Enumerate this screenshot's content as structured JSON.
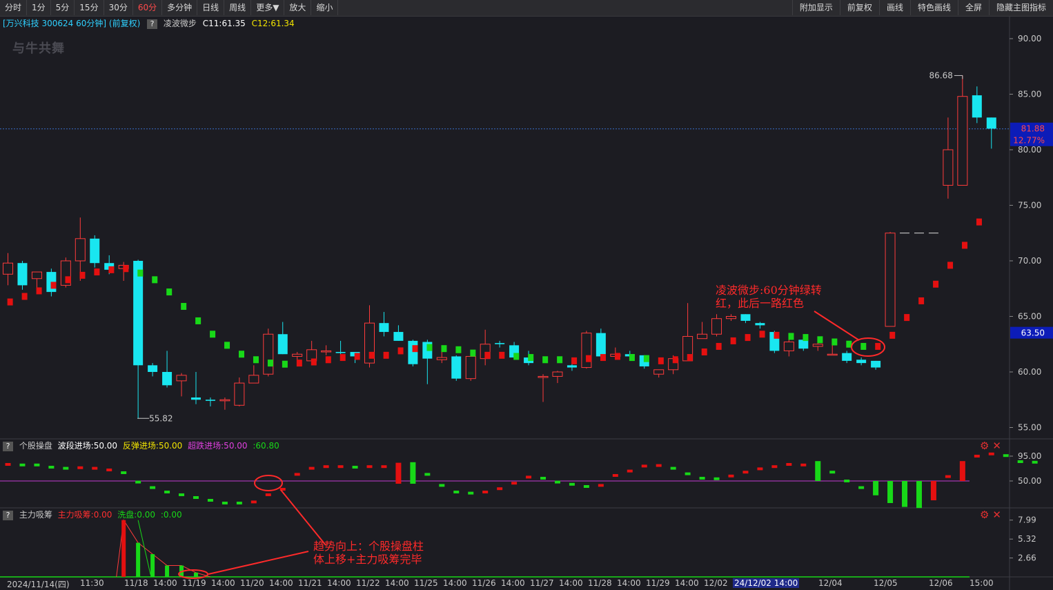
{
  "toolbar": {
    "left": [
      "分时",
      "1分",
      "5分",
      "15分",
      "30分",
      "60分",
      "多分钟",
      "日线",
      "周线",
      "更多▼",
      "放大",
      "缩小"
    ],
    "active": "60分",
    "right": [
      "附加显示",
      "前复权",
      "画线",
      "特色画线",
      "全屏",
      "隐藏主图指标"
    ]
  },
  "info": {
    "stock": "[万兴科技 300624 60分钟] (前复权)",
    "q": "?",
    "indicator": "凌波微步",
    "c11": "C11:61.35",
    "c12": "C12:61.34"
  },
  "watermark": "与牛共舞",
  "indicator1": {
    "name": "个股操盘",
    "v1": "波段进场:50.00",
    "v2": "反弹进场:50.00",
    "v3": "超跌进场:50.00",
    "v4": ":60.80",
    "yticks": [
      "95.00",
      "50.00"
    ]
  },
  "indicator2": {
    "name": "主力吸筹",
    "v1": "主力吸筹:0.00",
    "v2": "洗盘:0.00",
    "v3": ":0.00",
    "yticks": [
      "7.99",
      "5.32",
      "2.66"
    ]
  },
  "ctrl_icons": [
    "gear-icon",
    "close-icon"
  ],
  "price_axis": {
    "ticks": [
      "90.00",
      "85.00",
      "80.00",
      "75.00",
      "70.00",
      "65.00",
      "60.00",
      "55.00"
    ],
    "current": "81.88",
    "change": "12.77%",
    "cursor": "63.50",
    "high_label": "86.68",
    "low_label": "55.82"
  },
  "xaxis": [
    "2024/11/14(四)",
    "11:30",
    "11/18",
    "14:00",
    "11/19",
    "14:00",
    "11/20",
    "14:00",
    "11/21",
    "14:00",
    "11/22",
    "14:00",
    "11/25",
    "14:00",
    "11/26",
    "14:00",
    "11/27",
    "14:00",
    "11/28",
    "14:00",
    "11/29",
    "14:00",
    "12/02",
    "24/12/02 14:00",
    "12/04",
    "12/05",
    "12/06",
    "15:00"
  ],
  "annotations": {
    "a1_line1": "凌波微步:60分钟绿转",
    "a1_line2": "红，此后一路红色",
    "a2_line1": "趋势向上：个股操盘柱",
    "a2_line2": "体上移+主力吸筹完毕"
  },
  "colors": {
    "up": "#ff3b3b",
    "down": "#19e6f0",
    "green_dot": "#18d818",
    "red_dot": "#e41010",
    "magenta": "#c43bd4",
    "annot": "#ff2a2a"
  },
  "chart_data": {
    "type": "candlestick",
    "candles": [
      [
        68.8,
        69.8,
        67.8,
        70.7
      ],
      [
        69.8,
        67.8,
        67.4,
        70.0
      ],
      [
        68.4,
        69.0,
        67.6,
        69.0
      ],
      [
        69.0,
        67.2,
        66.8,
        69.3
      ],
      [
        67.8,
        70.0,
        67.6,
        70.3
      ],
      [
        70.0,
        72.0,
        68.2,
        73.9
      ],
      [
        72.0,
        69.8,
        69.4,
        72.3
      ],
      [
        69.8,
        69.2,
        68.8,
        70.5
      ],
      [
        69.3,
        69.6,
        68.2,
        69.9
      ],
      [
        70.0,
        60.6,
        55.8,
        70.1
      ],
      [
        60.6,
        60.0,
        59.6,
        60.8
      ],
      [
        60.0,
        58.8,
        58.6,
        61.9
      ],
      [
        59.2,
        59.7,
        57.8,
        59.9
      ],
      [
        57.7,
        57.5,
        57.1,
        60.0
      ],
      [
        57.5,
        57.4,
        56.9,
        57.7
      ],
      [
        57.4,
        57.5,
        56.6,
        57.7
      ],
      [
        57.0,
        59.0,
        56.9,
        59.5
      ],
      [
        59.0,
        59.7,
        59.0,
        60.6
      ],
      [
        59.8,
        63.4,
        59.6,
        63.9
      ],
      [
        63.4,
        61.6,
        61.6,
        64.5
      ],
      [
        61.4,
        61.6,
        61.1,
        61.8
      ],
      [
        61.0,
        62.0,
        61.0,
        62.8
      ],
      [
        61.8,
        61.9,
        61.5,
        62.4
      ],
      [
        61.8,
        61.7,
        61.3,
        62.8
      ],
      [
        61.8,
        61.4,
        60.8,
        61.8
      ],
      [
        60.8,
        64.4,
        60.4,
        66.0
      ],
      [
        64.4,
        63.6,
        63.2,
        65.4
      ],
      [
        63.6,
        62.8,
        62.8,
        64.2
      ],
      [
        62.8,
        60.7,
        60.5,
        62.9
      ],
      [
        62.7,
        61.2,
        58.9,
        62.9
      ],
      [
        61.1,
        61.3,
        60.8,
        61.8
      ],
      [
        61.4,
        59.4,
        59.2,
        61.5
      ],
      [
        59.4,
        61.4,
        59.2,
        61.7
      ],
      [
        61.2,
        62.5,
        60.6,
        63.8
      ],
      [
        62.6,
        62.5,
        62.2,
        62.8
      ],
      [
        62.4,
        61.3,
        61.3,
        62.7
      ],
      [
        61.3,
        60.8,
        60.6,
        61.9
      ],
      [
        59.5,
        59.6,
        57.3,
        59.8
      ],
      [
        59.6,
        60.0,
        59.0,
        60.1
      ],
      [
        60.6,
        60.4,
        60.1,
        61.0
      ],
      [
        60.4,
        63.5,
        60.3,
        63.7
      ],
      [
        63.5,
        61.4,
        61.4,
        63.9
      ],
      [
        61.4,
        61.6,
        61.1,
        62.2
      ],
      [
        61.6,
        61.4,
        61.4,
        61.9
      ],
      [
        61.5,
        60.5,
        60.3,
        61.5
      ],
      [
        59.8,
        60.2,
        59.5,
        60.2
      ],
      [
        60.2,
        61.2,
        59.8,
        61.5
      ],
      [
        61.0,
        63.2,
        61.0,
        66.2
      ],
      [
        63.0,
        63.4,
        63.0,
        64.5
      ],
      [
        63.4,
        64.8,
        63.2,
        65.2
      ],
      [
        64.8,
        65.0,
        64.6,
        65.2
      ],
      [
        65.2,
        64.6,
        64.4,
        65.2
      ],
      [
        64.4,
        64.2,
        63.9,
        64.5
      ],
      [
        63.6,
        61.9,
        61.7,
        63.7
      ],
      [
        61.9,
        62.7,
        61.4,
        62.9
      ],
      [
        62.9,
        62.1,
        61.9,
        63.2
      ],
      [
        62.3,
        62.5,
        61.9,
        62.7
      ],
      [
        61.6,
        61.6,
        61.6,
        62.4
      ],
      [
        61.7,
        61.0,
        60.8,
        61.9
      ],
      [
        61.1,
        60.8,
        60.6,
        61.3
      ],
      [
        61.0,
        60.4,
        60.2,
        61.0
      ],
      [
        64.1,
        72.5,
        64.1,
        72.6
      ],
      [
        72.5,
        72.5,
        72.5,
        72.6
      ],
      [
        72.5,
        72.5,
        72.5,
        72.6
      ],
      [
        72.5,
        72.5,
        72.5,
        72.6
      ],
      [
        76.8,
        80.0,
        75.6,
        82.9
      ],
      [
        76.8,
        84.8,
        76.8,
        86.7
      ],
      [
        84.9,
        82.9,
        82.4,
        85.7
      ],
      [
        82.9,
        81.9,
        80.1,
        82.9
      ]
    ],
    "overlay": [
      [
        66.3,
        "r"
      ],
      [
        66.8,
        "r"
      ],
      [
        67.3,
        "r"
      ],
      [
        67.8,
        "r"
      ],
      [
        68.3,
        "r"
      ],
      [
        68.7,
        "r"
      ],
      [
        69.0,
        "r"
      ],
      [
        69.2,
        "r"
      ],
      [
        69.3,
        "r"
      ],
      [
        68.9,
        "g"
      ],
      [
        68.3,
        "g"
      ],
      [
        67.2,
        "g"
      ],
      [
        65.9,
        "g"
      ],
      [
        64.6,
        "g"
      ],
      [
        63.4,
        "g"
      ],
      [
        62.4,
        "g"
      ],
      [
        61.6,
        "g"
      ],
      [
        61.1,
        "g"
      ],
      [
        60.8,
        "g"
      ],
      [
        60.7,
        "g"
      ],
      [
        60.8,
        "r"
      ],
      [
        60.9,
        "r"
      ],
      [
        61.1,
        "r"
      ],
      [
        61.3,
        "r"
      ],
      [
        61.4,
        "r"
      ],
      [
        61.5,
        "r"
      ],
      [
        61.5,
        "r"
      ],
      [
        61.9,
        "r"
      ],
      [
        62.1,
        "r"
      ],
      [
        62.2,
        "g"
      ],
      [
        62.1,
        "g"
      ],
      [
        62.0,
        "g"
      ],
      [
        61.7,
        "g"
      ],
      [
        61.5,
        "r"
      ],
      [
        61.5,
        "r"
      ],
      [
        61.4,
        "g"
      ],
      [
        61.3,
        "g"
      ],
      [
        61.1,
        "g"
      ],
      [
        61.1,
        "g"
      ],
      [
        61.0,
        "r"
      ],
      [
        61.2,
        "r"
      ],
      [
        61.3,
        "r"
      ],
      [
        61.4,
        "r"
      ],
      [
        61.3,
        "g"
      ],
      [
        61.2,
        "g"
      ],
      [
        61.0,
        "r"
      ],
      [
        61.1,
        "r"
      ],
      [
        61.3,
        "r"
      ],
      [
        61.8,
        "r"
      ],
      [
        62.3,
        "r"
      ],
      [
        62.8,
        "r"
      ],
      [
        63.1,
        "r"
      ],
      [
        63.4,
        "r"
      ],
      [
        63.3,
        "r"
      ],
      [
        63.2,
        "g"
      ],
      [
        63.1,
        "g"
      ],
      [
        62.9,
        "g"
      ],
      [
        62.7,
        "g"
      ],
      [
        62.5,
        "g"
      ],
      [
        62.3,
        "g"
      ],
      [
        62.3,
        "r"
      ],
      [
        63.3,
        "r"
      ],
      [
        64.9,
        "r"
      ],
      [
        66.4,
        "r"
      ],
      [
        67.9,
        "r"
      ],
      [
        69.6,
        "r"
      ],
      [
        71.4,
        "r"
      ],
      [
        73.5,
        "r"
      ]
    ],
    "ind1": [
      [
        80,
        "r"
      ],
      [
        79,
        "g"
      ],
      [
        79,
        "g"
      ],
      [
        75,
        "g"
      ],
      [
        73,
        "g"
      ],
      [
        74,
        "r"
      ],
      [
        73,
        "r"
      ],
      [
        70,
        "r"
      ],
      [
        65,
        "g"
      ],
      [
        48,
        "g"
      ],
      [
        38,
        "g"
      ],
      [
        30,
        "g"
      ],
      [
        25,
        "g"
      ],
      [
        20,
        "g"
      ],
      [
        15,
        "g"
      ],
      [
        10,
        "g"
      ],
      [
        10,
        "g"
      ],
      [
        12,
        "r"
      ],
      [
        25,
        "r"
      ],
      [
        35,
        "r"
      ],
      [
        62,
        "r"
      ],
      [
        73,
        "r"
      ],
      [
        76,
        "r"
      ],
      [
        76,
        "r"
      ],
      [
        75,
        "g"
      ],
      [
        76,
        "r"
      ],
      [
        76,
        "r"
      ],
      [
        78,
        "r"
      ],
      [
        79,
        "g"
      ],
      [
        62,
        "g"
      ],
      [
        42,
        "g"
      ],
      [
        30,
        "g"
      ],
      [
        28,
        "g"
      ],
      [
        30,
        "r"
      ],
      [
        36,
        "r"
      ],
      [
        46,
        "r"
      ],
      [
        57,
        "r"
      ],
      [
        55,
        "g"
      ],
      [
        48,
        "g"
      ],
      [
        44,
        "g"
      ],
      [
        40,
        "g"
      ],
      [
        42,
        "r"
      ],
      [
        60,
        "r"
      ],
      [
        68,
        "r"
      ],
      [
        77,
        "r"
      ],
      [
        78,
        "r"
      ],
      [
        73,
        "g"
      ],
      [
        63,
        "g"
      ],
      [
        55,
        "g"
      ],
      [
        54,
        "g"
      ],
      [
        59,
        "r"
      ],
      [
        66,
        "r"
      ],
      [
        72,
        "r"
      ],
      [
        76,
        "r"
      ],
      [
        80,
        "r"
      ],
      [
        79,
        "r"
      ],
      [
        86,
        "g"
      ],
      [
        66,
        "g"
      ],
      [
        50,
        "g"
      ],
      [
        38,
        "g"
      ],
      [
        24,
        "g"
      ],
      [
        10,
        "g"
      ],
      [
        3,
        "g"
      ],
      [
        1,
        "g"
      ],
      [
        15,
        "r"
      ],
      [
        58,
        "r"
      ],
      [
        86,
        "r"
      ],
      [
        95,
        "r"
      ],
      [
        99,
        "r"
      ],
      [
        96,
        "g"
      ],
      [
        85,
        "g"
      ],
      [
        84,
        "g"
      ]
    ],
    "ind2": [
      [
        8,
        7.99
      ],
      [
        9,
        4.8
      ],
      [
        10,
        3.2
      ],
      [
        11,
        1.6
      ],
      [
        12,
        1.6
      ],
      [
        13,
        0.6
      ]
    ]
  }
}
